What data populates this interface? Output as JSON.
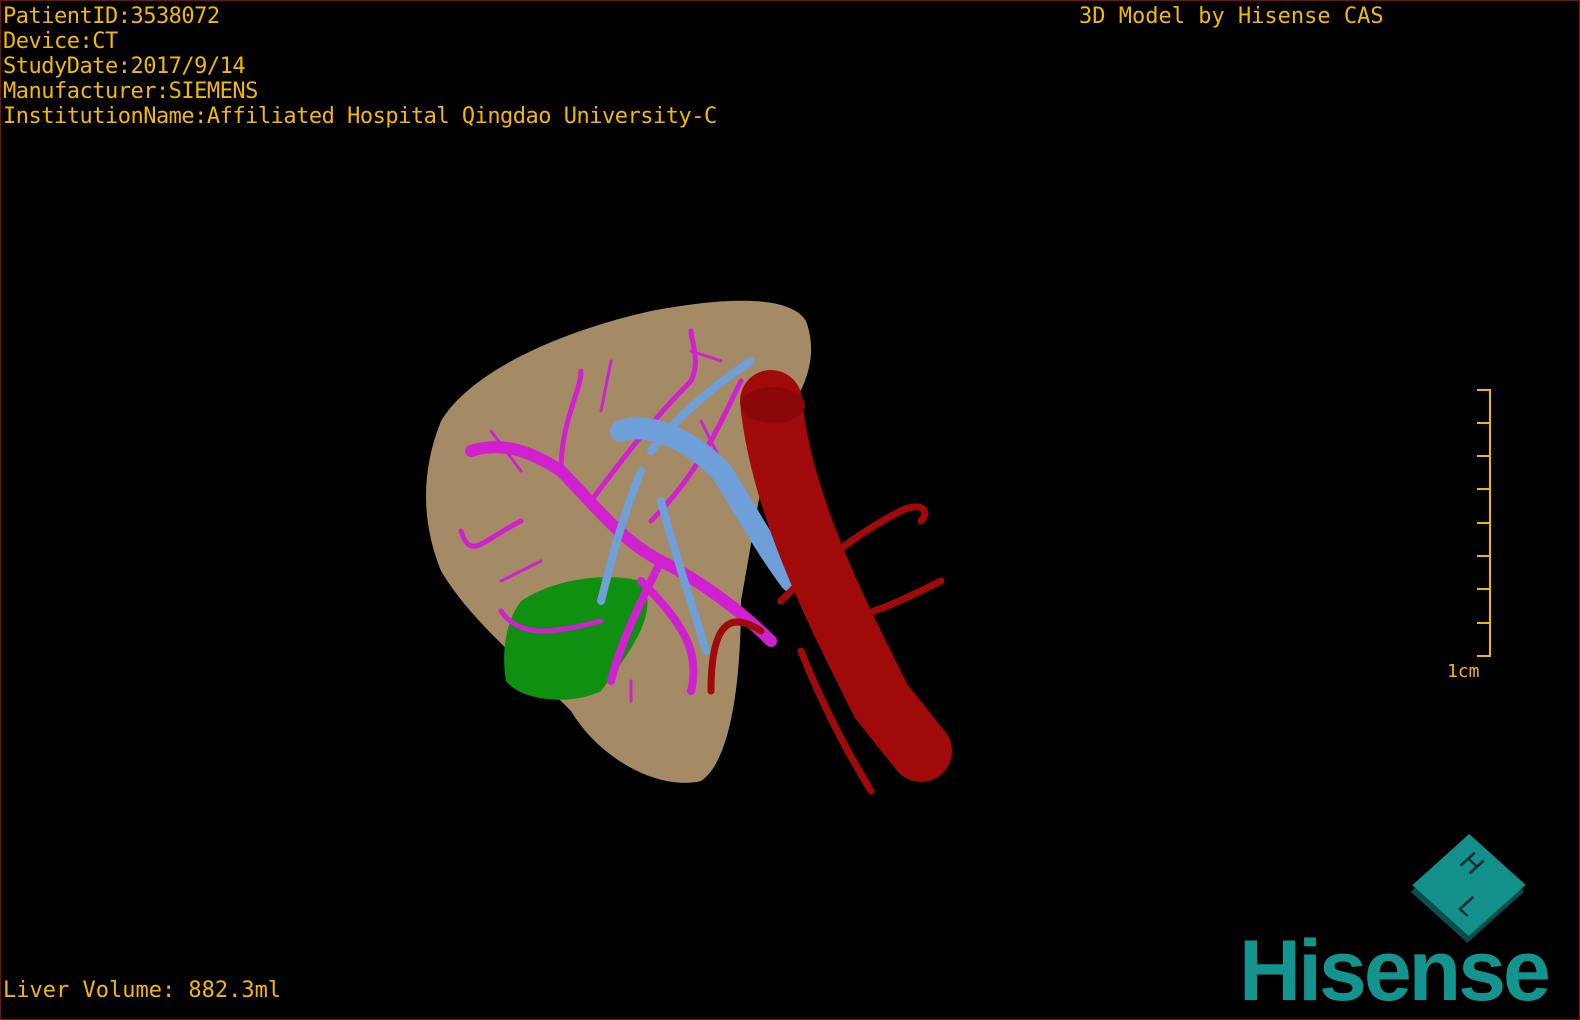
{
  "overlay": {
    "patient_id": "PatientID:3538072",
    "device": "Device:CT",
    "study_date": "StudyDate:2017/9/14",
    "manufacturer": "Manufacturer:SIEMENS",
    "institution": "InstitutionName:Affiliated Hospital Qingdao University-C",
    "credit": "3D Model by Hisense CAS",
    "liver_volume": "Liver Volume: 882.3ml"
  },
  "scale": {
    "label": "1cm"
  },
  "orientation_cube": {
    "face_letters": [
      "H",
      "L"
    ]
  },
  "logo": {
    "brand": "Hisense"
  },
  "colors": {
    "text": "#f5b800",
    "liver": "#a58a66",
    "portal_vein": "#d020d0",
    "hepatic_vein": "#6f9fd8",
    "artery_ivc": "#a00a0a",
    "gallbladder": "#109010",
    "brand": "#14948f"
  }
}
